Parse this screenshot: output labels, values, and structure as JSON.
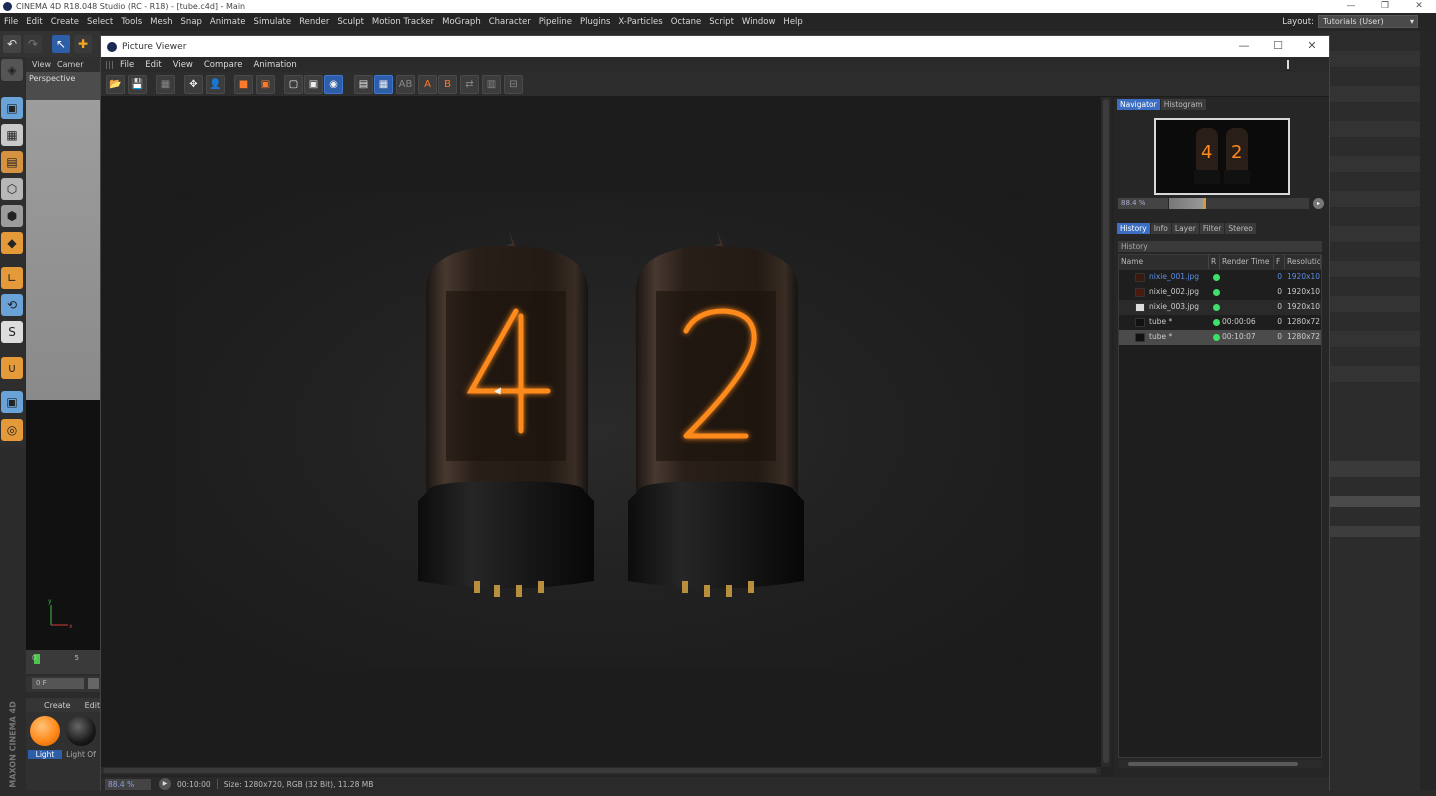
{
  "app": {
    "title": "CINEMA 4D R18.048 Studio (RC - R18) - [tube.c4d] - Main",
    "menu": [
      "File",
      "Edit",
      "Create",
      "Select",
      "Tools",
      "Mesh",
      "Snap",
      "Animate",
      "Simulate",
      "Render",
      "Sculpt",
      "Motion Tracker",
      "MoGraph",
      "Character",
      "Pipeline",
      "Plugins",
      "X-Particles",
      "Octane",
      "Script",
      "Window",
      "Help"
    ],
    "layout_label": "Layout:",
    "layout_value": "Tutorials (User)"
  },
  "viewport": {
    "menu": [
      "View",
      "Camer"
    ],
    "label": "Perspective"
  },
  "timeline": {
    "tick_0": "0",
    "tick_5": "5",
    "frame": "0 F"
  },
  "materials": {
    "menu": [
      "Create",
      "Edit"
    ],
    "items": [
      {
        "name": "Light",
        "color": "#ff8a1a"
      },
      {
        "name": "Light Of",
        "color": "#1a1a1a"
      }
    ]
  },
  "brand": "MAXON CINEMA 4D",
  "picture_viewer": {
    "title": "Picture Viewer",
    "menu": [
      "File",
      "Edit",
      "View",
      "Compare",
      "Animation"
    ],
    "render_digits": [
      "4",
      "2"
    ],
    "status": {
      "zoom": "88.4 %",
      "time": "00:10:00",
      "info": "Size: 1280x720, RGB (32 Bit), 11.28 MB"
    },
    "navigator_tabs": [
      "Navigator",
      "Histogram"
    ],
    "navigator_zoom": "88.4 %",
    "navigator_zoom_fraction": 0.25,
    "history_tabs": [
      "History",
      "Info",
      "Layer",
      "Filter",
      "Stereo"
    ],
    "history_header": "History",
    "columns": [
      "Name",
      "R",
      "Render Time",
      "F",
      "Resolutio"
    ],
    "rows": [
      {
        "name": "nixie_001.jpg",
        "time": "",
        "f": "0",
        "res": "1920x10",
        "link": true
      },
      {
        "name": "nixie_002.jpg",
        "time": "",
        "f": "0",
        "res": "1920x10",
        "link": false
      },
      {
        "name": "nixie_003.jpg",
        "time": "",
        "f": "0",
        "res": "1920x10",
        "link": false
      },
      {
        "name": "tube *",
        "time": "00:00:06",
        "f": "0",
        "res": "1280x72",
        "link": false
      },
      {
        "name": "tube *",
        "time": "00:10:07",
        "f": "0",
        "res": "1280x72",
        "link": false
      }
    ]
  },
  "colors": {
    "accent": "#3c6fc4",
    "nixie_glow": "#ff8a1a",
    "status_green": "#3ee06a"
  }
}
